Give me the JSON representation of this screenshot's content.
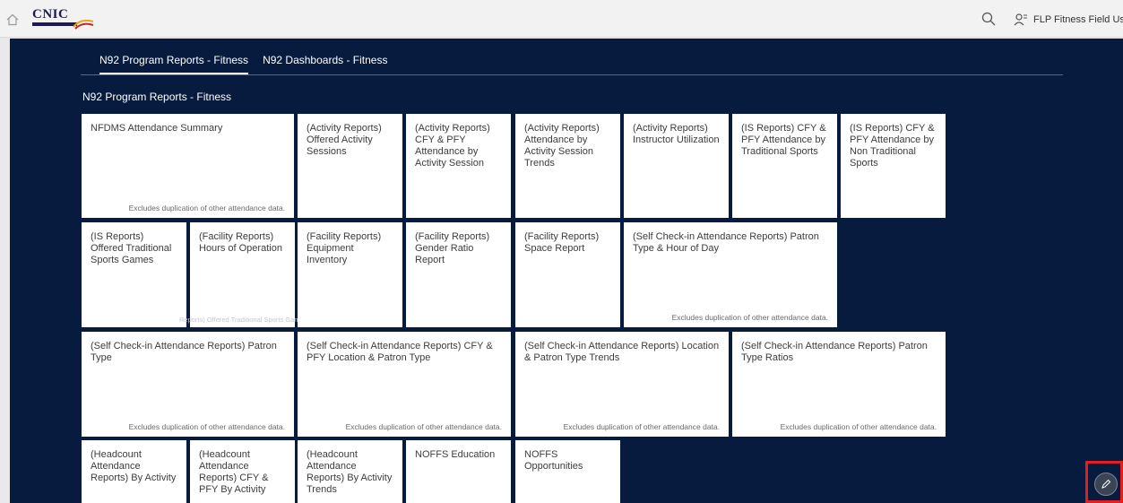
{
  "header": {
    "logo_text": "CNIC",
    "user_name": "FLP Fitness Field User"
  },
  "tabs": [
    {
      "label": "N92 Program Reports - Fitness",
      "active": true
    },
    {
      "label": "N92 Dashboards - Fitness",
      "active": false
    }
  ],
  "section_title": "N92 Program Reports - Fitness",
  "tiles": [
    {
      "title": "NFDMS Attendance Summary",
      "footer": "Excludes duplication of other attendance data."
    },
    {
      "title": "(Activity Reports) Offered Activity Sessions"
    },
    {
      "title": "(Activity Reports) CFY & PFY Attendance by Activity Session"
    },
    {
      "title": "(Activity Reports) Attendance by Activity Session Trends"
    },
    {
      "title": "(Activity Reports) Instructor Utilization"
    },
    {
      "title": "(IS Reports) CFY & PFY Attendance by Traditional Sports"
    },
    {
      "title": "(IS Reports) CFY & PFY Attendance by Non Traditional Sports"
    },
    {
      "title": "(IS Reports) Offered Traditional Sports Games"
    },
    {
      "title": "(Facility Reports) Hours of Operation",
      "ghost": "Reports) Offered Traditional Sports Games"
    },
    {
      "title": "(Facility Reports) Equipment Inventory"
    },
    {
      "title": "(Facility Reports) Gender Ratio Report"
    },
    {
      "title": "(Facility Reports) Space Report"
    },
    {
      "title": "(Self Check-in Attendance Reports) Patron Type & Hour of Day",
      "footer": "Excludes duplication of other attendance data."
    },
    {
      "title": "(Self Check-in Attendance Reports) Patron Type",
      "footer": "Excludes duplication of other attendance data."
    },
    {
      "title": "(Self Check-in Attendance Reports) CFY & PFY Location & Patron Type",
      "footer": "Excludes duplication of other attendance data."
    },
    {
      "title": "(Self Check-in Attendance Reports) Location & Patron Type Trends",
      "footer": "Excludes duplication of other attendance data."
    },
    {
      "title": "(Self Check-in Attendance Reports) Patron Type Ratios",
      "footer": "Excludes duplication of other attendance data."
    },
    {
      "title": "(Headcount Attendance Reports) By Activity"
    },
    {
      "title": "(Headcount Attendance Reports) CFY & PFY By Activity"
    },
    {
      "title": "(Headcount Attendance Reports) By Activity Trends"
    },
    {
      "title": "NOFFS Education"
    },
    {
      "title": "NOFFS Opportunities"
    }
  ],
  "icons": {
    "home": "home-icon",
    "search": "search-icon",
    "user": "user-icon",
    "edit": "pencil-icon"
  },
  "colors": {
    "background": "#061b3e",
    "tile": "#ffffff",
    "highlight": "#e01f25"
  }
}
